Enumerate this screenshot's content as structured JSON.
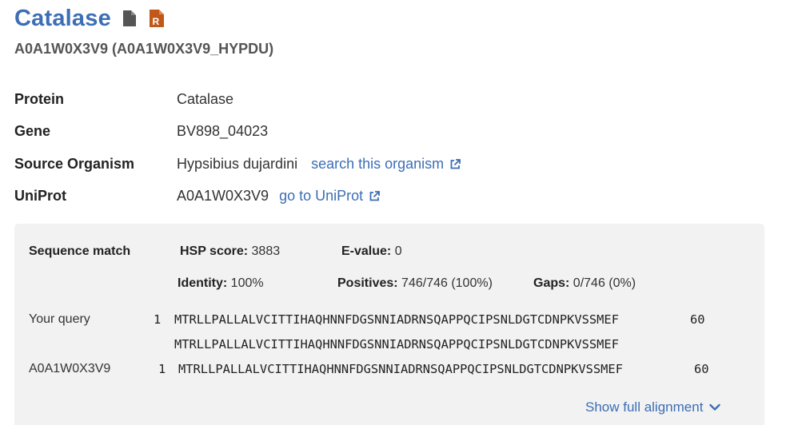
{
  "header": {
    "title": "Catalase",
    "doc_icon": "document-icon",
    "r_icon": "r-file-icon",
    "subtitle": "A0A1W0X3V9 (A0A1W0X3V9_HYPDU)"
  },
  "info": {
    "protein_label": "Protein",
    "protein_value": "Catalase",
    "gene_label": "Gene",
    "gene_value": "BV898_04023",
    "organism_label": "Source Organism",
    "organism_value": "Hypsibius dujardini",
    "organism_link": "search this organism",
    "uniprot_label": "UniProt",
    "uniprot_value": "A0A1W0X3V9",
    "uniprot_link": "go to UniProt"
  },
  "match": {
    "heading": "Sequence match",
    "hsp_label": "HSP score:",
    "hsp_value": "3883",
    "evalue_label": "E-value:",
    "evalue_value": "0",
    "identity_label": "Identity:",
    "identity_value": "100%",
    "positives_label": "Positives:",
    "positives_value": "746/746 (100%)",
    "gaps_label": "Gaps:",
    "gaps_value": "0/746 (0%)",
    "query_label": "Your query",
    "query_start": "1",
    "query_seq": "MTRLLPALLALVCITTIHAQHNNFDGSNNIADRNSQAPPQCIPSNLDGTCDNPKVSSMEF",
    "query_end": "60",
    "match_seq": "MTRLLPALLALVCITTIHAQHNNFDGSNNIADRNSQAPPQCIPSNLDGTCDNPKVSSMEF",
    "subject_label": "A0A1W0X3V9",
    "subject_start": "1",
    "subject_seq": "MTRLLPALLALVCITTIHAQHNNFDGSNNIADRNSQAPPQCIPSNLDGTCDNPKVSSMEF",
    "subject_end": "60",
    "show_full": "Show full alignment"
  },
  "colors": {
    "accent": "#3c6eb4",
    "r_icon": "#c2571a",
    "panel_bg": "#f2f2f2"
  }
}
